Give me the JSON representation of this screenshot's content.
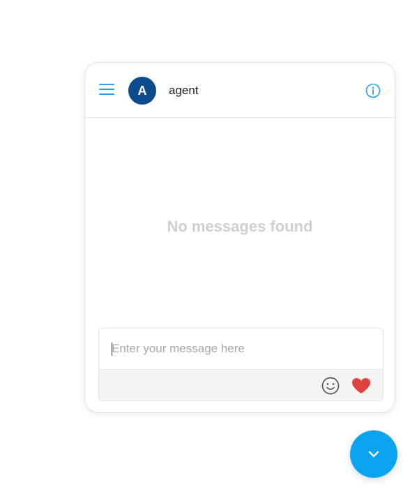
{
  "header": {
    "avatar_initial": "A",
    "agent_name": "agent"
  },
  "conversation": {
    "empty_text": "No messages found"
  },
  "composer": {
    "placeholder": "Enter your message here",
    "value": ""
  },
  "icons": {
    "menu": "hamburger-menu-icon",
    "info": "info-icon",
    "emoji": "smiley-icon",
    "heart": "heart-icon",
    "collapse": "chevron-down-icon"
  },
  "colors": {
    "accent": "#2b9be3",
    "avatar_bg": "#0b4a8c",
    "fab_bg": "#0aa3f0",
    "heart": "#e0403f",
    "empty_text": "#cfcfcf"
  }
}
